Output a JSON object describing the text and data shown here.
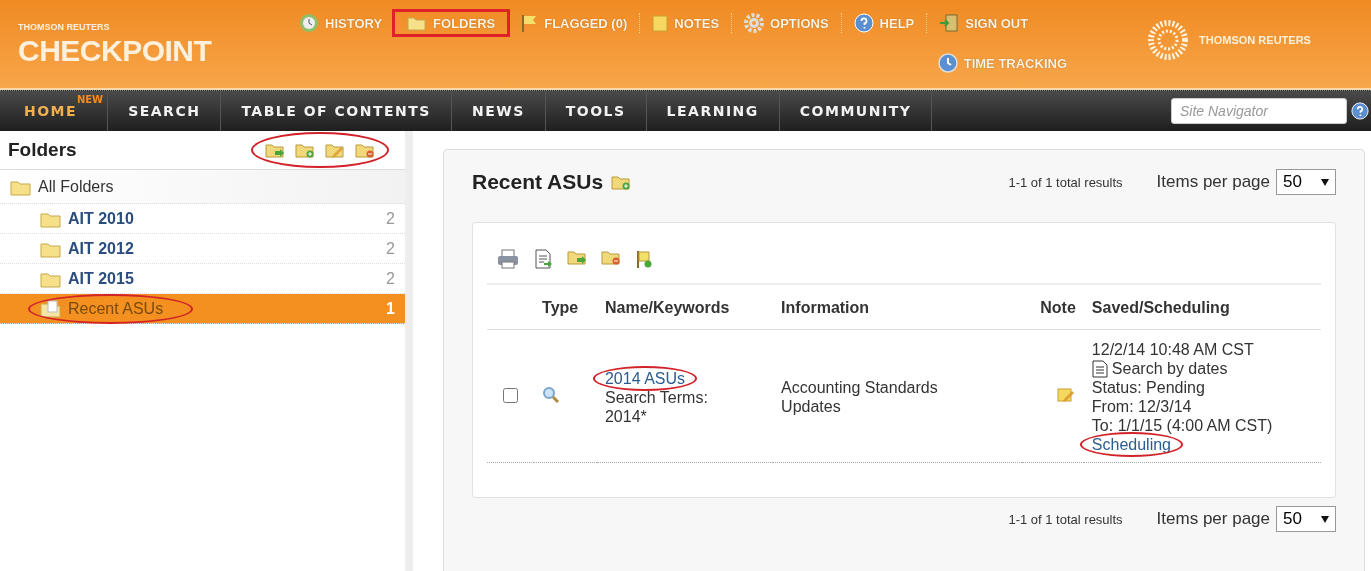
{
  "header": {
    "brand_small": "THOMSON REUTERS",
    "brand": "CHECKPOINT",
    "links": [
      {
        "label": "HISTORY",
        "kind": "history",
        "boxed": false
      },
      {
        "label": "FOLDERS",
        "kind": "folders",
        "boxed": true
      },
      {
        "label": "FLAGGED (0)",
        "kind": "flagged",
        "boxed": false
      },
      {
        "label": "NOTES",
        "kind": "notes",
        "boxed": false
      },
      {
        "label": "OPTIONS",
        "kind": "options",
        "boxed": false
      },
      {
        "label": "HELP",
        "kind": "help",
        "boxed": false
      },
      {
        "label": "SIGN OUT",
        "kind": "signout",
        "boxed": false
      }
    ],
    "time_tracking": "TIME TRACKING",
    "corp_logo": "THOMSON REUTERS"
  },
  "nav": {
    "items": [
      {
        "label": "HOME",
        "badge": "NEW",
        "selected": true
      },
      {
        "label": "SEARCH",
        "selected": false
      },
      {
        "label": "TABLE OF CONTENTS",
        "selected": false
      },
      {
        "label": "NEWS",
        "selected": false
      },
      {
        "label": "TOOLS",
        "selected": false
      },
      {
        "label": "LEARNING",
        "selected": false
      },
      {
        "label": "COMMUNITY",
        "selected": false
      }
    ],
    "search": {
      "placeholder": "Site Navigator"
    }
  },
  "sidebar": {
    "title": "Folders",
    "toolbar_circled": true,
    "folders": [
      {
        "label": "All Folders",
        "selected": false,
        "circled": false,
        "children": [
          {
            "label": "AIT 2010",
            "count": "2",
            "selected": false,
            "circled": false
          },
          {
            "label": "AIT 2012",
            "count": "2",
            "selected": false,
            "circled": false
          },
          {
            "label": "AIT 2015",
            "count": "2",
            "selected": false,
            "circled": false
          },
          {
            "label": "Recent ASUs",
            "count": "1",
            "selected": true,
            "circled": true
          }
        ]
      }
    ]
  },
  "main": {
    "title": "Recent ASUs",
    "results": "1-1 of 1 total results",
    "per_page_label": "Items per page",
    "per_page": "50",
    "table": {
      "columns": [
        "Type",
        "Name/Keywords",
        "Information",
        "Note",
        "Saved/Scheduling"
      ],
      "rows": [
        {
          "checked": false,
          "name": "2014 ASUs",
          "name_circled": true,
          "terms": "Search Terms: 2014*",
          "information": "Accounting Standards Updates",
          "saved": "12/2/14 10:48 AM CST",
          "schedule": "Search by dates",
          "status": "Status: Pending",
          "from": "From: 12/3/14",
          "to": "To: 1/1/15 (4:00 AM CST)",
          "link": "Scheduling",
          "link_circled": true
        }
      ]
    },
    "footer_results": "1-1 of 1 total results",
    "footer_per_page_label": "Items per page",
    "footer_per_page": "50"
  }
}
